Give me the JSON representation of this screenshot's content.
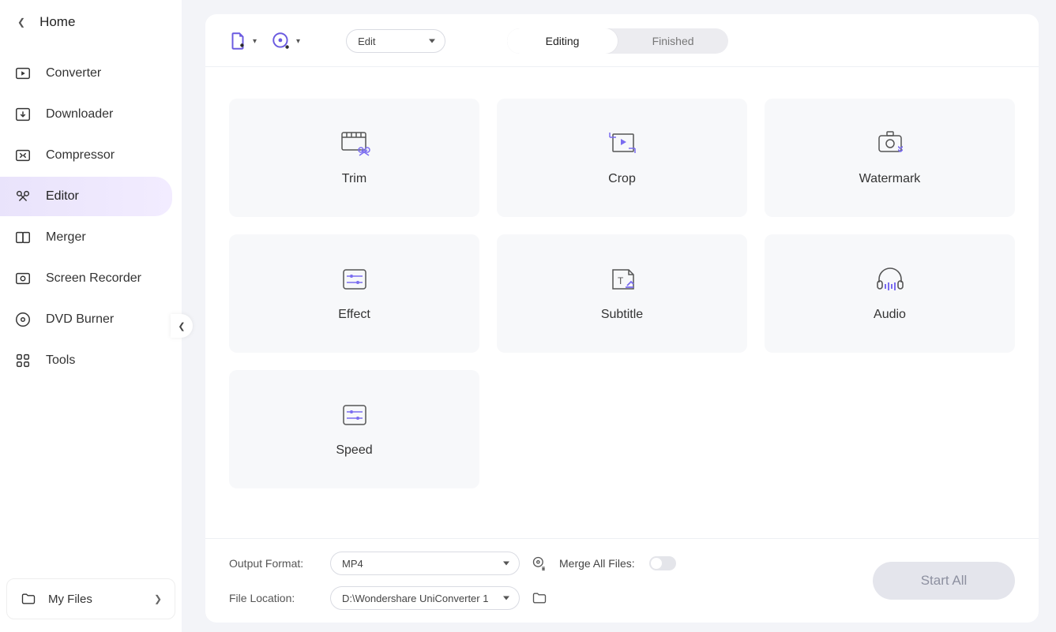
{
  "home_label": "Home",
  "sidebar": {
    "items": [
      {
        "label": "Converter"
      },
      {
        "label": "Downloader"
      },
      {
        "label": "Compressor"
      },
      {
        "label": "Editor"
      },
      {
        "label": "Merger"
      },
      {
        "label": "Screen Recorder"
      },
      {
        "label": "DVD Burner"
      },
      {
        "label": "Tools"
      }
    ]
  },
  "my_files_label": "My Files",
  "toolbar": {
    "edit_select": "Edit",
    "tabs": {
      "editing": "Editing",
      "finished": "Finished"
    }
  },
  "cards": {
    "trim": "Trim",
    "crop": "Crop",
    "watermark": "Watermark",
    "effect": "Effect",
    "subtitle": "Subtitle",
    "audio": "Audio",
    "speed": "Speed"
  },
  "footer": {
    "output_format_label": "Output Format:",
    "output_format_value": "MP4",
    "file_location_label": "File Location:",
    "file_location_value": "D:\\Wondershare UniConverter 1",
    "merge_label": "Merge All Files:",
    "start_label": "Start All"
  }
}
